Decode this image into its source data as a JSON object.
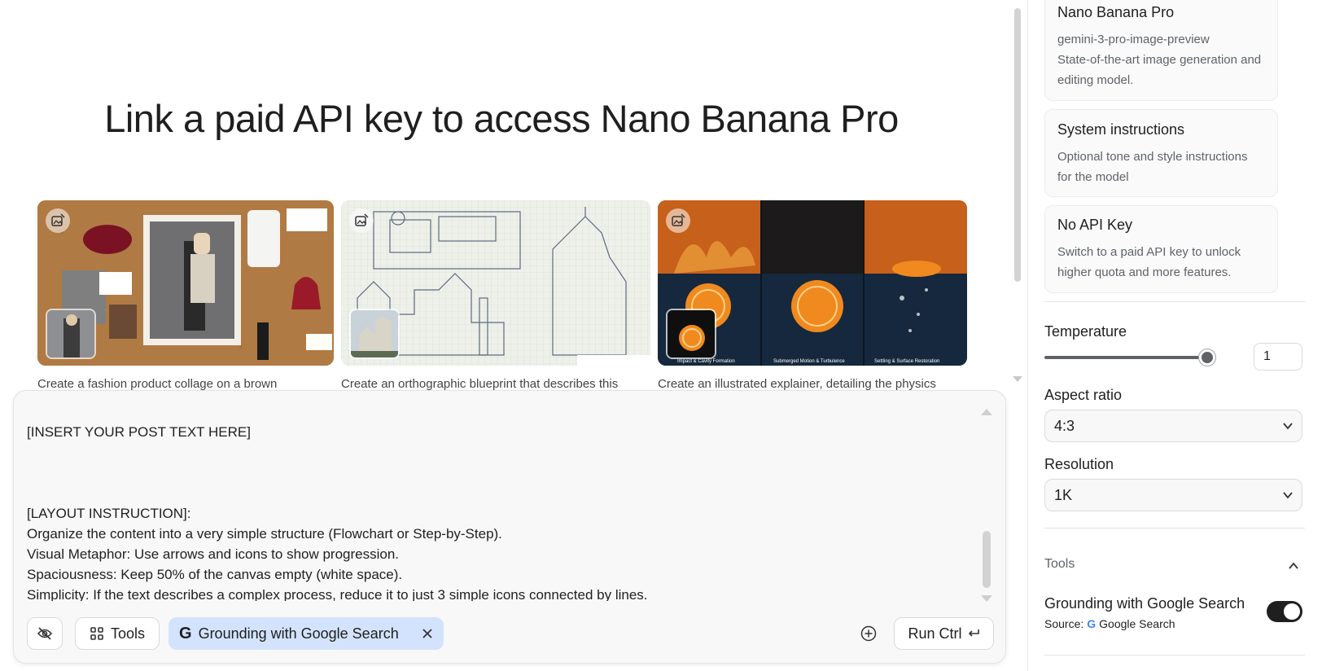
{
  "main": {
    "headline": "Link a paid API key to access Nano Banana Pro",
    "cards": [
      {
        "caption": "Create a fashion product collage on a brown"
      },
      {
        "caption": "Create an orthographic blueprint that describes this"
      },
      {
        "caption": "Create an illustrated explainer, detailing the physics"
      }
    ]
  },
  "prompt": {
    "text": "[INSERT YOUR POST TEXT HERE]\n\n\n\n[LAYOUT INSTRUCTION]:\nOrganize the content into a very simple structure (Flowchart or Step-by-Step).\nVisual Metaphor: Use arrows and icons to show progression.\nSpaciousness: Keep 50% of the canvas empty (white space).\nSimplicity: If the text describes a complex process, reduce it to just 3 simple icons connected by lines.",
    "tools_label": "Tools",
    "grounding_chip_label": "Grounding with Google Search",
    "run_label": "Run Ctrl"
  },
  "side": {
    "model": {
      "title": "Nano Banana Pro",
      "id": "gemini-3-pro-image-preview",
      "description": "State-of-the-art image generation and editing model."
    },
    "system_instructions": {
      "title": "System instructions",
      "description": "Optional tone and style instructions for the model"
    },
    "api_key": {
      "title": "No API Key",
      "description": "Switch to a paid API key to unlock higher quota and more features."
    },
    "temperature": {
      "label": "Temperature",
      "value": "1",
      "slider_fraction": 1.0
    },
    "aspect_ratio": {
      "label": "Aspect ratio",
      "value": "4:3"
    },
    "resolution": {
      "label": "Resolution",
      "value": "1K"
    },
    "tools": {
      "header": "Tools",
      "grounding_title": "Grounding with Google Search",
      "source_label": "Source:",
      "source_name": "Google Search",
      "grounding_enabled": true
    }
  },
  "colors": {
    "chip_bg": "#d3e3fd",
    "toggle_on": "#1f1f1f",
    "panel_bg": "#f8f8f8"
  }
}
